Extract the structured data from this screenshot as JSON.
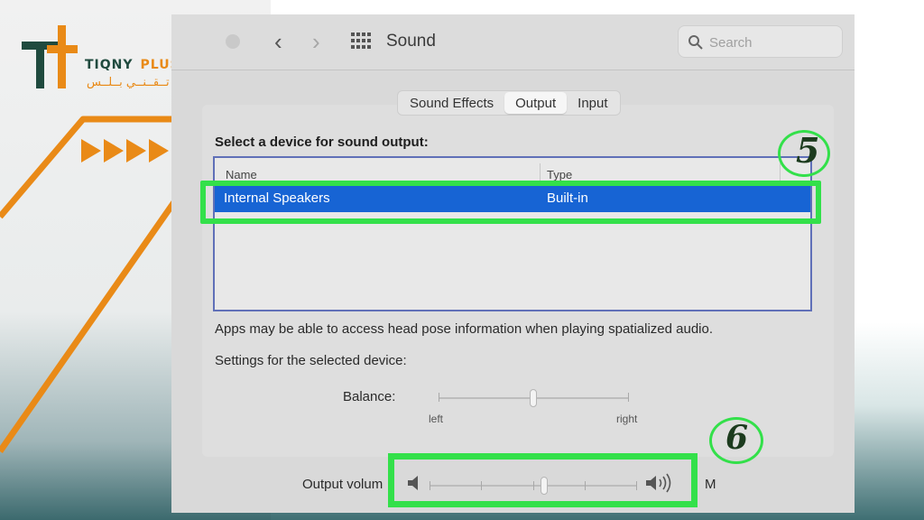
{
  "branding": {
    "logo_en_main": "TIQNY",
    "logo_en_accent": "PLUS",
    "logo_ar": "تــقــنــي بــلــس",
    "colors": {
      "green": "#1f4a3e",
      "orange": "#e98a17",
      "highlight": "#33e04a"
    }
  },
  "window": {
    "title": "Sound",
    "back_icon": "‹",
    "forward_icon": "›",
    "search_placeholder": "Search"
  },
  "tabs": [
    {
      "label": "Sound Effects",
      "active": false
    },
    {
      "label": "Output",
      "active": true
    },
    {
      "label": "Input",
      "active": false
    }
  ],
  "output": {
    "select_label": "Select a device for sound output:",
    "columns": {
      "name": "Name",
      "type": "Type"
    },
    "devices": [
      {
        "name": "Internal Speakers",
        "type": "Built-in",
        "selected": true
      }
    ],
    "apps_note": "Apps may be able to access head pose information when playing spatialized audio.",
    "settings_label": "Settings for the selected device:",
    "balance": {
      "label": "Balance:",
      "left": "left",
      "right": "right",
      "value": 0.5
    },
    "output_volume": {
      "label": "Output volum",
      "value": 0.55,
      "trailing": "M"
    }
  },
  "annotations": {
    "step_5": "5",
    "step_6": "6"
  }
}
